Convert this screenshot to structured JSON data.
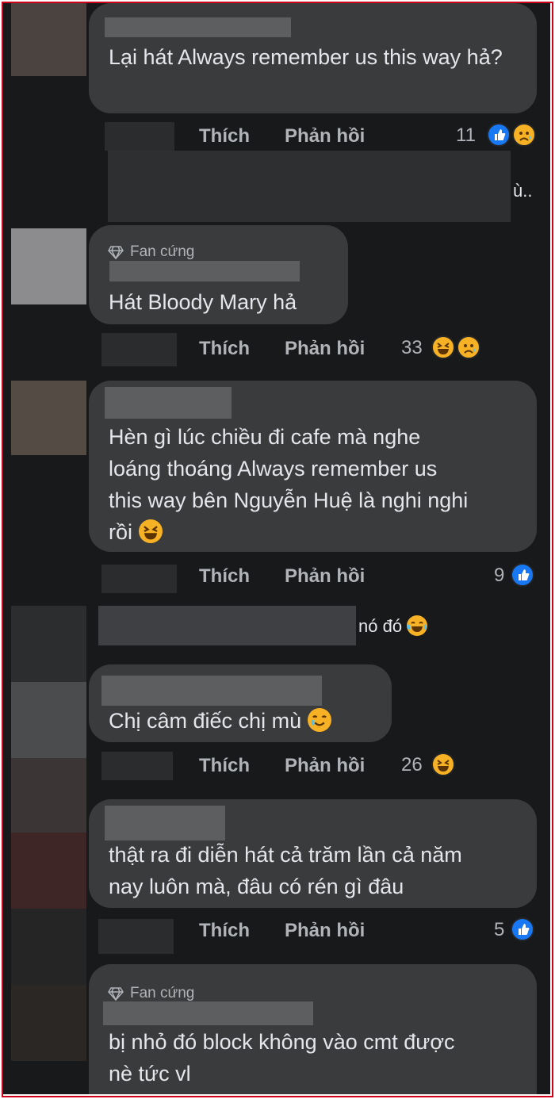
{
  "comments": [
    {
      "text": "Lại hát Always remember us this way hả?",
      "like_label": "Thích",
      "reply_label": "Phản hồi",
      "reaction_count": "11",
      "reactions": [
        "like",
        "sad"
      ]
    },
    {
      "badge": "Fan cứng",
      "text": "Hát Bloody Mary hả",
      "like_label": "Thích",
      "reply_label": "Phản hồi",
      "reaction_count": "33",
      "reactions": [
        "haha",
        "sad"
      ]
    },
    {
      "text_line1": "Hèn gì lúc chiều đi cafe mà nghe",
      "text_line2": "loáng thoáng Always remember us",
      "text_line3": "this way bên Nguyễn Huệ là nghi nghi",
      "text_line4": "rồi",
      "like_label": "Thích",
      "reply_label": "Phản hồi",
      "reaction_count": "9",
      "reactions": [
        "like"
      ]
    },
    {
      "text": "Chị câm điếc chị mù",
      "like_label": "Thích",
      "reply_label": "Phản hồi",
      "reaction_count": "26",
      "reactions": [
        "haha"
      ]
    },
    {
      "text_line1": "thật ra đi diễn hát cả trăm lần cả năm",
      "text_line2": "nay luôn mà, đâu có rén gì đâu",
      "like_label": "Thích",
      "reply_label": "Phản hồi",
      "reaction_count": "5",
      "reactions": [
        "like"
      ]
    },
    {
      "badge": "Fan cứng",
      "text_line1": "bị nhỏ đó block không vào cmt được",
      "text_line2": "nè tức vl"
    }
  ],
  "snippets": {
    "reply_preview_tail": "ù..",
    "mention_text": "nó đó"
  },
  "colors": {
    "background": "#18191a",
    "bubble": "#3a3b3c",
    "text": "#e4e6eb",
    "muted": "#b0b3b8",
    "like_blue": "#1877f2",
    "emoji_yellow": "#f7b125",
    "frame_red": "#d0021b"
  }
}
